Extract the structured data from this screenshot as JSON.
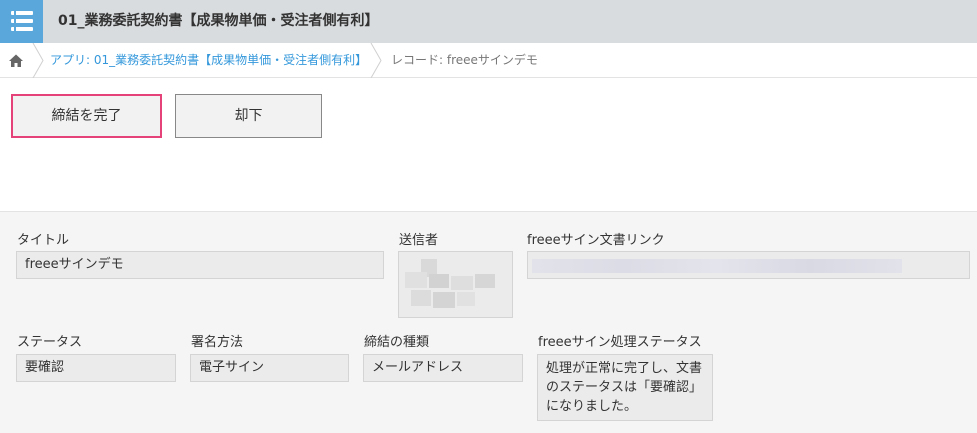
{
  "header": {
    "title": "01_業務委託契約書【成果物単価・受注者側有利】",
    "app_icon": "list-icon"
  },
  "breadcrumb": {
    "home_icon": "home-icon",
    "app_crumb": "アプリ: 01_業務委託契約書【成果物単価・受注者側有利】",
    "record_crumb": "レコード: freeeサインデモ"
  },
  "actions": {
    "complete_label": "締結を完了",
    "reject_label": "却下",
    "accent_color": "#e5427a"
  },
  "fields": {
    "title": {
      "label": "タイトル",
      "value": "freeeサインデモ"
    },
    "sender": {
      "label": "送信者"
    },
    "doc_link": {
      "label": "freeeサイン文書リンク"
    },
    "status": {
      "label": "ステータス",
      "value": "要確認"
    },
    "sign_method": {
      "label": "署名方法",
      "value": "電子サイン"
    },
    "contract_type": {
      "label": "締結の種類",
      "value": "メールアドレス"
    },
    "process_status": {
      "label": "freeeサイン処理ステータス",
      "value": "処理が正常に完了し、文書\nのステータスは「要確認」\nになりました。"
    }
  }
}
